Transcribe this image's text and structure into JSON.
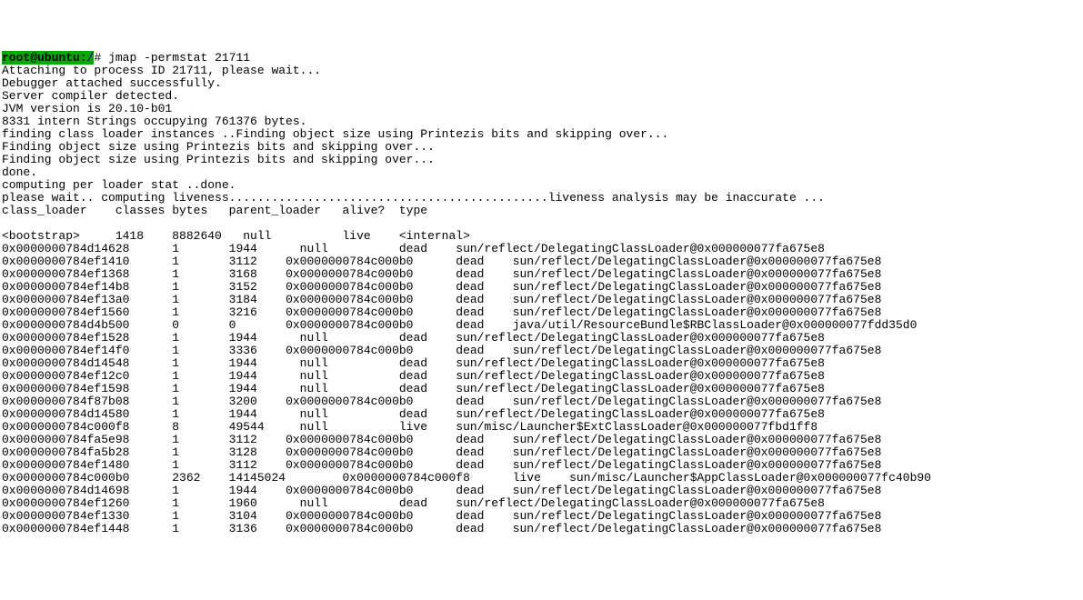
{
  "prompt": {
    "user_host": "root@ubuntu",
    "sep": ":",
    "path": "/",
    "end": "#",
    "command": " jmap -permstat 21711"
  },
  "preamble": [
    "Attaching to process ID 21711, please wait...",
    "Debugger attached successfully.",
    "Server compiler detected.",
    "JVM version is 20.10-b01",
    "8331 intern Strings occupying 761376 bytes.",
    "finding class loader instances ..Finding object size using Printezis bits and skipping over...",
    "Finding object size using Printezis bits and skipping over...",
    "Finding object size using Printezis bits and skipping over...",
    "done.",
    "computing per loader stat ..done.",
    "please wait.. computing liveness.............................................liveness analysis may be inaccurate ...",
    "class_loader\tclasses\tbytes\tparent_loader\talive?\ttype",
    ""
  ],
  "rows": [
    "<bootstrap>\t1418\t8882640\t  null  \tlive\t<internal>",
    "0x0000000784d14628\t1\t1944\t  null  \tdead\tsun/reflect/DelegatingClassLoader@0x000000077fa675e8",
    "0x0000000784ef1410\t1\t3112\t0x0000000784c000b0\tdead\tsun/reflect/DelegatingClassLoader@0x000000077fa675e8",
    "0x0000000784ef1368\t1\t3168\t0x0000000784c000b0\tdead\tsun/reflect/DelegatingClassLoader@0x000000077fa675e8",
    "0x0000000784ef14b8\t1\t3152\t0x0000000784c000b0\tdead\tsun/reflect/DelegatingClassLoader@0x000000077fa675e8",
    "0x0000000784ef13a0\t1\t3184\t0x0000000784c000b0\tdead\tsun/reflect/DelegatingClassLoader@0x000000077fa675e8",
    "0x0000000784ef1560\t1\t3216\t0x0000000784c000b0\tdead\tsun/reflect/DelegatingClassLoader@0x000000077fa675e8",
    "0x0000000784d4b500\t0\t0\t0x0000000784c000b0\tdead\tjava/util/ResourceBundle$RBClassLoader@0x000000077fdd35d0",
    "0x0000000784ef1528\t1\t1944\t  null  \tdead\tsun/reflect/DelegatingClassLoader@0x000000077fa675e8",
    "0x0000000784ef14f0\t1\t3336\t0x0000000784c000b0\tdead\tsun/reflect/DelegatingClassLoader@0x000000077fa675e8",
    "0x0000000784d14548\t1\t1944\t  null  \tdead\tsun/reflect/DelegatingClassLoader@0x000000077fa675e8",
    "0x0000000784ef12c0\t1\t1944\t  null  \tdead\tsun/reflect/DelegatingClassLoader@0x000000077fa675e8",
    "0x0000000784ef1598\t1\t1944\t  null  \tdead\tsun/reflect/DelegatingClassLoader@0x000000077fa675e8",
    "0x0000000784f87b08\t1\t3200\t0x0000000784c000b0\tdead\tsun/reflect/DelegatingClassLoader@0x000000077fa675e8",
    "0x0000000784d14580\t1\t1944\t  null  \tdead\tsun/reflect/DelegatingClassLoader@0x000000077fa675e8",
    "0x0000000784c000f8\t8\t49544\t  null  \tlive\tsun/misc/Launcher$ExtClassLoader@0x000000077fbd1ff8",
    "0x0000000784fa5e98\t1\t3112\t0x0000000784c000b0\tdead\tsun/reflect/DelegatingClassLoader@0x000000077fa675e8",
    "0x0000000784fa5b28\t1\t3128\t0x0000000784c000b0\tdead\tsun/reflect/DelegatingClassLoader@0x000000077fa675e8",
    "0x0000000784ef1480\t1\t3112\t0x0000000784c000b0\tdead\tsun/reflect/DelegatingClassLoader@0x000000077fa675e8",
    "0x0000000784c000b0\t2362\t14145024\t0x0000000784c000f8\tlive\tsun/misc/Launcher$AppClassLoader@0x000000077fc40b90",
    "0x0000000784d14698\t1\t1944\t0x0000000784c000b0\tdead\tsun/reflect/DelegatingClassLoader@0x000000077fa675e8",
    "0x0000000784ef1260\t1\t1960\t  null  \tdead\tsun/reflect/DelegatingClassLoader@0x000000077fa675e8",
    "0x0000000784ef1330\t1\t3104\t0x0000000784c000b0\tdead\tsun/reflect/DelegatingClassLoader@0x000000077fa675e8",
    "0x0000000784ef1448\t1\t3136\t0x0000000784c000b0\tdead\tsun/reflect/DelegatingClassLoader@0x000000077fa675e8"
  ]
}
